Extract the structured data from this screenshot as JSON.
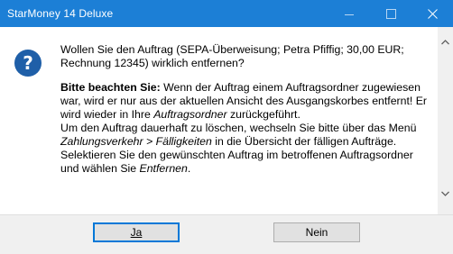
{
  "window": {
    "title": "StarMoney 14 Deluxe",
    "minimize_icon": "minimize-icon",
    "maximize_icon": "maximize-icon",
    "close_icon": "close-icon"
  },
  "dialog": {
    "icon": "question-icon",
    "question": "Wollen Sie den Auftrag (SEPA-Überweisung; Petra Pfiffig; 30,00 EUR; Rechnung 12345) wirklich entfernen?",
    "note_label": "Bitte beachten Sie:",
    "note_text_1": " Wenn der Auftrag einem Auftragsordner zugewiesen war, wird er nur aus der aktuellen Ansicht des Ausgangskorbes entfernt! Er wird wieder in Ihre ",
    "note_italic_1": "Auftragsordner",
    "note_text_2": " zurückgeführt.",
    "line2_text_1": "Um den Auftrag dauerhaft zu löschen, wechseln Sie bitte über das Menü ",
    "line2_italic_1": "Zahlungsverkehr > Fälligkeiten",
    "line2_text_2": " in die Übersicht der fälligen Aufträge. Selektieren Sie den gewünschten Auftrag im betroffenen Auftragsordner und wählen Sie ",
    "line2_italic_2": "Entfernen",
    "line2_text_3": "."
  },
  "buttons": {
    "yes_label": "Ja",
    "no_label": "Nein"
  },
  "scrollbar": {
    "up_icon": "scroll-up-arrow-icon",
    "down_icon": "scroll-down-arrow-icon"
  }
}
